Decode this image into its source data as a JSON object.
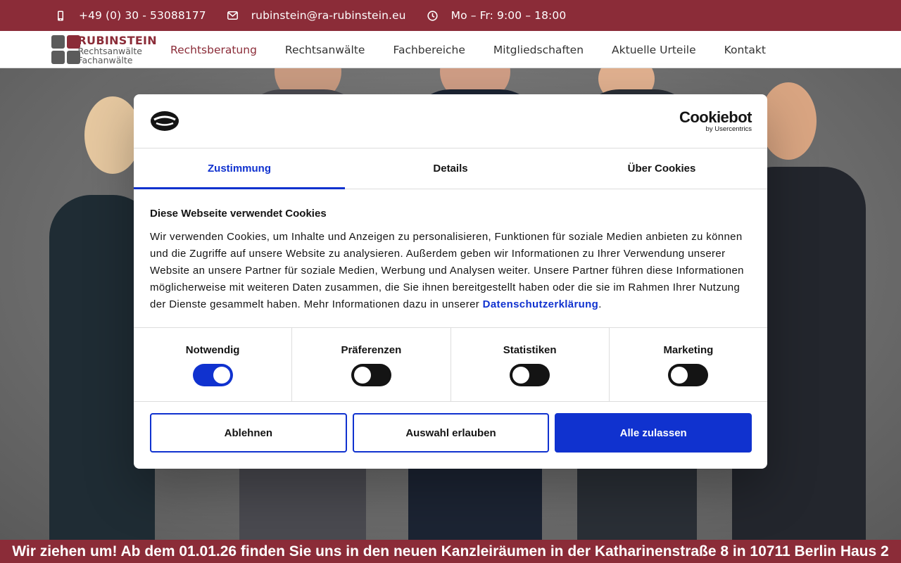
{
  "topbar": {
    "phone": "+49 (0) 30 - 53088177",
    "email": "rubinstein@ra-rubinstein.eu",
    "hours": "Mo – Fr: 9:00 – 18:00"
  },
  "logo": {
    "brand": "RUBINSTEIN",
    "line1": "Rechtsanwälte",
    "line2": "Fachanwälte"
  },
  "nav": {
    "items": [
      {
        "label": "Rechtsberatung",
        "active": true
      },
      {
        "label": "Rechtsanwälte"
      },
      {
        "label": "Fachbereiche"
      },
      {
        "label": "Mitgliedschaften"
      },
      {
        "label": "Aktuelle Urteile"
      },
      {
        "label": "Kontakt"
      }
    ]
  },
  "banner": {
    "text": "Wir ziehen um! Ab dem 01.01.26 finden Sie uns in den neuen Kanzleiräumen in der Katharinenstraße 8 in 10711 Berlin Haus 2"
  },
  "cookie": {
    "provider": "Cookiebot",
    "provider_sub": "by Usercentrics",
    "tabs": [
      "Zustimmung",
      "Details",
      "Über Cookies"
    ],
    "active_tab": "Zustimmung",
    "title": "Diese Webseite verwendet Cookies",
    "text": "Wir verwenden Cookies, um Inhalte und Anzeigen zu personalisieren, Funktionen für soziale Medien anbieten zu kön­nen und die Zugriffe auf unsere Website zu analysieren. Außerdem geben wir Informationen zu Ihrer Verwendung unse­rer Website an unsere Partner für soziale Medien, Werbung und Analysen weiter. Unsere Partner führen diese Informa­tionen möglicherweise mit weiteren Daten zusammen, die Sie ihnen bereitgestellt haben oder die sie im Rahmen Ihrer Nutzung der Dienste gesammelt haben. Mehr Informationen dazu in unserer ",
    "link": "Datenschutzerklärung",
    "text_end": ".",
    "toggles": [
      {
        "label": "Notwendig",
        "on": true
      },
      {
        "label": "Präferenzen",
        "on": false
      },
      {
        "label": "Statistiken",
        "on": false
      },
      {
        "label": "Marketing",
        "on": false
      }
    ],
    "buttons": {
      "decline": "Ablehnen",
      "selection": "Auswahl erlauben",
      "accept_all": "Alle zulassen"
    }
  },
  "colors": {
    "brand": "#8b2c38",
    "cookiebot_blue": "#1032cf"
  }
}
